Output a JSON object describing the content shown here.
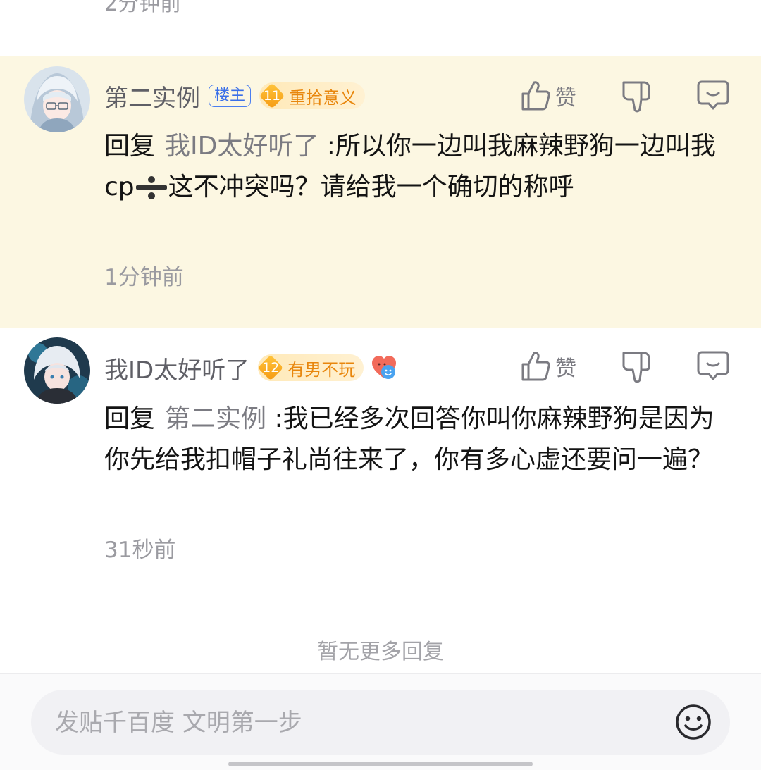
{
  "previous_comment": {
    "time": "2分钟前"
  },
  "comments": [
    {
      "username": "第二实例",
      "owner_badge": "楼主",
      "level": "11",
      "level_title": "重拾意义",
      "like_label": "赞",
      "reply_prefix": "回复",
      "mention": "我ID太好听了",
      "text_part1": " :所以你一边叫我麻辣野狗一边叫我cp",
      "text_part2": "这不冲突吗？请给我一个确切的称呼",
      "time": "1分钟前",
      "highlighted": true
    },
    {
      "username": "我ID太好听了",
      "level": "12",
      "level_title": "有男不玩",
      "like_label": "赞",
      "reply_prefix": "回复",
      "mention": "第二实例",
      "text_part1": " :我已经多次回答你叫你麻辣野狗是因为你先给我扣帽子礼尚往来了，你有多心虚还要问一遍？",
      "time": "31秒前",
      "highlighted": false
    }
  ],
  "footer": {
    "no_more": "暂无更多回复"
  },
  "input": {
    "placeholder": "发贴千百度 文明第一步"
  },
  "colors": {
    "highlight_bg": "#fcf7e2",
    "level_text": "#e8860c",
    "owner_badge": "#3a6fe8"
  }
}
